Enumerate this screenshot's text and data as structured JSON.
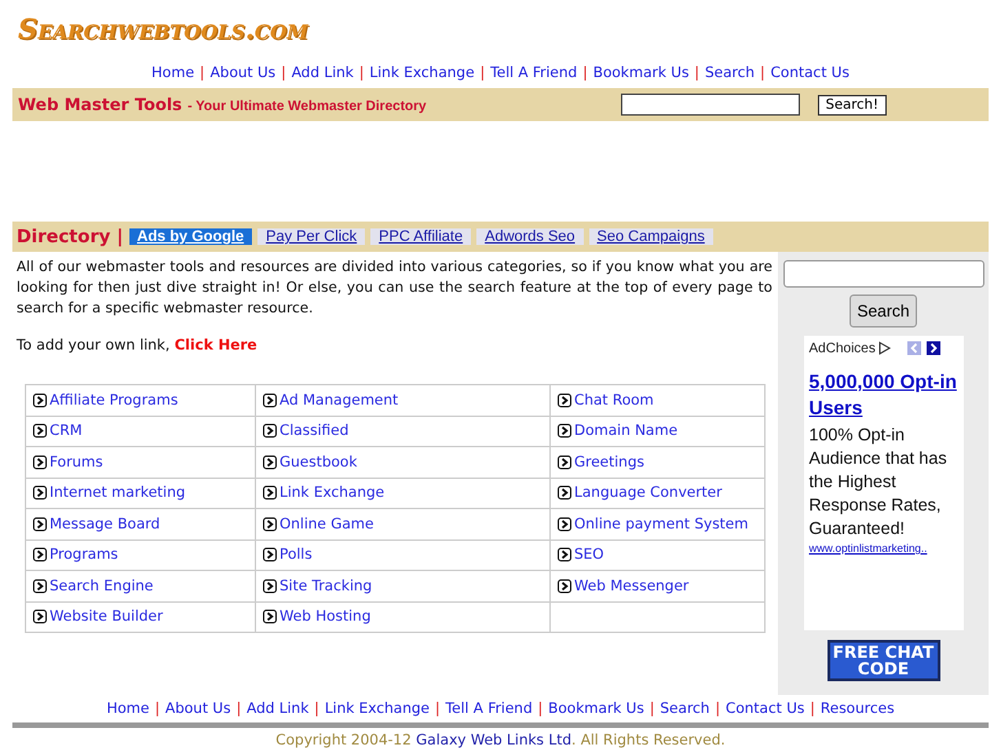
{
  "logo": {
    "text": "Searchwebtools.com"
  },
  "top_nav": [
    {
      "kind": "link",
      "text": "Home"
    },
    {
      "kind": "separator",
      "text": "|"
    },
    {
      "kind": "link",
      "text": "About Us"
    },
    {
      "kind": "separator",
      "text": "|"
    },
    {
      "kind": "link",
      "text": "Add Link"
    },
    {
      "kind": "separator",
      "text": "|"
    },
    {
      "kind": "link",
      "text": "Link Exchange"
    },
    {
      "kind": "separator",
      "text": "|"
    },
    {
      "kind": "link",
      "text": "Tell A Friend"
    },
    {
      "kind": "separator",
      "text": "|"
    },
    {
      "kind": "link",
      "text": "Bookmark Us"
    },
    {
      "kind": "separator",
      "text": "|"
    },
    {
      "kind": "link",
      "text": "Search"
    },
    {
      "kind": "separator",
      "text": "|"
    },
    {
      "kind": "link",
      "text": "Contact Us"
    }
  ],
  "header_bar": {
    "title": "Web Master Tools",
    "tagline": "- Your Ultimate Webmaster Directory",
    "search_button": "Search!"
  },
  "directory_bar": {
    "label": "Directory |",
    "ad_links": [
      {
        "label": "Ads by Google",
        "selected": true
      },
      {
        "label": "Pay Per Click",
        "selected": false
      },
      {
        "label": "PPC Affiliate",
        "selected": false
      },
      {
        "label": "Adwords Seo",
        "selected": false
      },
      {
        "label": "Seo Campaigns",
        "selected": false
      }
    ]
  },
  "intro": "All of our webmaster tools and resources are divided into various categories, so if you know what you are looking for then just dive straight in! Or else, you can use the search feature at the top of every page to search for a specific webmaster resource.",
  "add_link": {
    "text": "To add your own link,",
    "link": "Click Here"
  },
  "categories": [
    [
      "Affiliate Programs",
      "Ad Management",
      "Chat Room"
    ],
    [
      "CRM",
      "Classified",
      "Domain Name"
    ],
    [
      "Forums",
      "Guestbook",
      "Greetings"
    ],
    [
      "Internet marketing",
      "Link Exchange",
      "Language Converter"
    ],
    [
      "Message Board",
      "Online Game",
      "Online payment System"
    ],
    [
      "Programs",
      "Polls",
      "SEO"
    ],
    [
      "Search Engine",
      "Site Tracking",
      "Web Messenger"
    ],
    [
      "Website Builder",
      "Web Hosting"
    ]
  ],
  "sidebar": {
    "search_button": "Search",
    "ad": {
      "adchoices": "AdChoices",
      "headline": "5,000,000 Opt-in Users",
      "body": "100% Opt-in Audience that has the Highest Response Rates, Guaranteed!",
      "url": "www.optinlistmarketing.."
    },
    "banner": "FREE CHAT CODE"
  },
  "bottom_nav": [
    {
      "kind": "link",
      "text": "Home"
    },
    {
      "kind": "separator",
      "text": "|"
    },
    {
      "kind": "link",
      "text": "About Us"
    },
    {
      "kind": "separator",
      "text": "|"
    },
    {
      "kind": "link",
      "text": "Add Link"
    },
    {
      "kind": "separator",
      "text": "|"
    },
    {
      "kind": "link",
      "text": "Link Exchange"
    },
    {
      "kind": "separator",
      "text": "|"
    },
    {
      "kind": "link",
      "text": "Tell A Friend"
    },
    {
      "kind": "separator",
      "text": "|"
    },
    {
      "kind": "link",
      "text": "Bookmark Us"
    },
    {
      "kind": "separator",
      "text": "|"
    },
    {
      "kind": "link",
      "text": "Search"
    },
    {
      "kind": "separator",
      "text": "|"
    },
    {
      "kind": "link",
      "text": "Contact Us"
    },
    {
      "kind": "separator",
      "text": "|"
    },
    {
      "kind": "link",
      "text": "Resources"
    }
  ],
  "copyright": {
    "before": "Copyright 2004-12",
    "link": "Galaxy Web Links Ltd",
    "after": ". All Rights Reserved."
  }
}
